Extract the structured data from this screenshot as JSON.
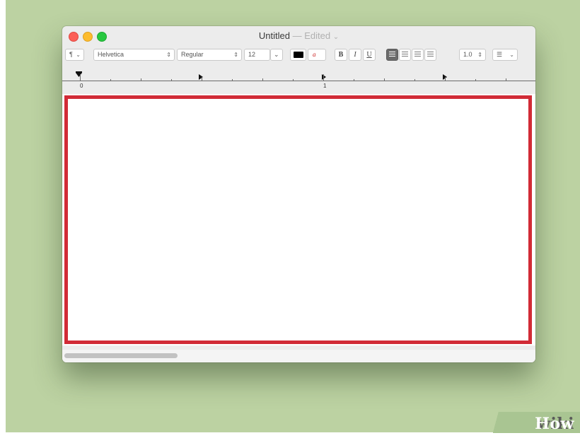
{
  "window": {
    "title": "Untitled",
    "separator": "—",
    "status": "Edited",
    "status_chevron": "⌄"
  },
  "toolbar": {
    "paragraph_style": "¶",
    "font_family": "Helvetica",
    "font_style": "Regular",
    "font_size": "12",
    "text_color": "#000000",
    "bold_label": "B",
    "italic_label": "I",
    "underline_label": "U",
    "line_spacing": "1.0",
    "list_icon": "list-bullets-icon",
    "alignment_selected": "left"
  },
  "ruler": {
    "marks": [
      "0",
      "1"
    ]
  },
  "highlight_color": "#d12b36",
  "watermark": {
    "part1": "wiki",
    "part2": "How"
  }
}
